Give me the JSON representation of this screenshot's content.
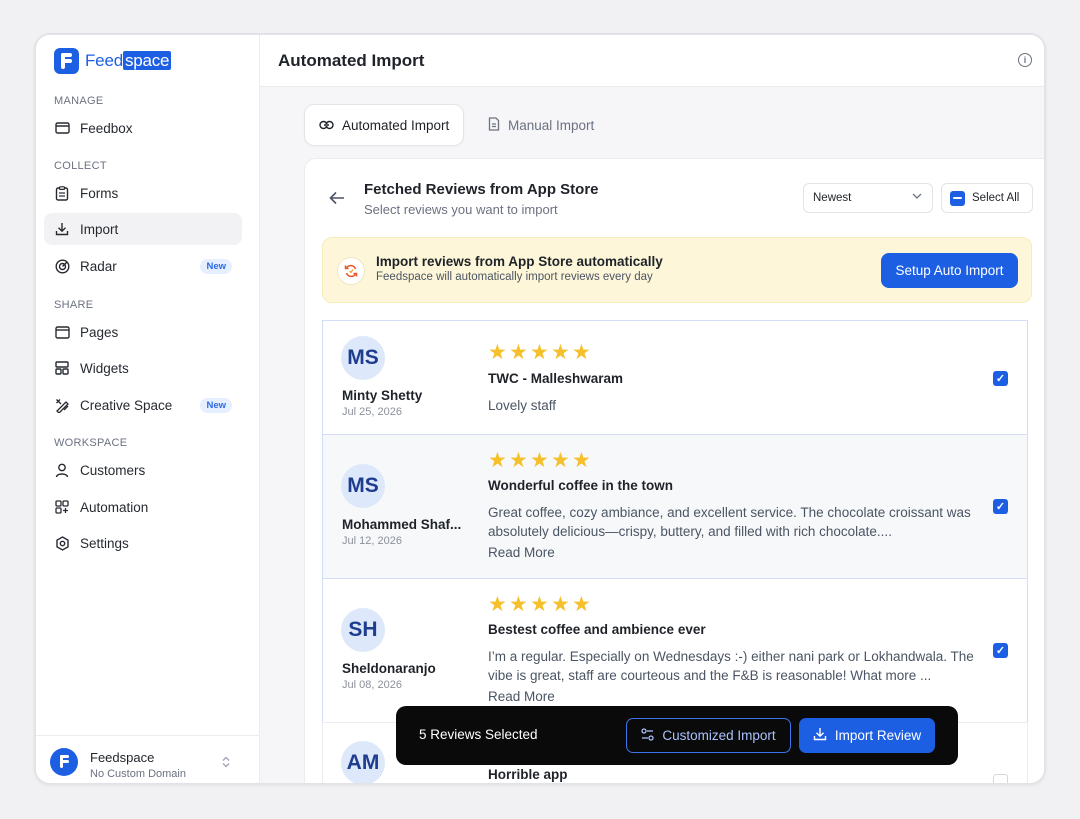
{
  "brand": {
    "name_part1": "Feed",
    "name_part2": "space"
  },
  "sidebar": {
    "sections": {
      "manage": "MANAGE",
      "collect": "COLLECT",
      "share": "SHARE",
      "workspace": "WORKSPACE"
    },
    "items": {
      "feedbox": "Feedbox",
      "forms": "Forms",
      "import": "Import",
      "radar": "Radar",
      "pages": "Pages",
      "widgets": "Widgets",
      "creative_space": "Creative Space",
      "customers": "Customers",
      "automation": "Automation",
      "settings": "Settings"
    },
    "badge_new": "New",
    "workspace": {
      "name": "Feedspace",
      "domain": "No Custom Domain"
    }
  },
  "header": {
    "title": "Automated Import"
  },
  "tabs": {
    "automated": "Automated Import",
    "manual": "Manual Import"
  },
  "panel": {
    "title": "Fetched Reviews from App Store",
    "subtitle": "Select reviews you want to import",
    "sort_value": "Newest",
    "select_all": "Select All"
  },
  "banner": {
    "title": "Import reviews from App Store automatically",
    "subtitle": "Feedspace will automatically import reviews every day",
    "button": "Setup Auto Import"
  },
  "reviews": [
    {
      "initials": "MS",
      "name": "Minty Shetty",
      "date": "Jul 25, 2026",
      "rating": 5,
      "title": "TWC - Malleshwaram",
      "body": "Lovely staff",
      "more": "",
      "checked": true
    },
    {
      "initials": "MS",
      "name": "Mohammed Shaf...",
      "date": "Jul 12, 2026",
      "rating": 5,
      "title": "Wonderful coffee in the town",
      "body": "Great coffee, cozy ambiance, and excellent service. The chocolate croissant was absolutely delicious—crispy, buttery, and filled with rich chocolate....",
      "more": "Read More",
      "checked": true
    },
    {
      "initials": "SH",
      "name": "Sheldonaranjo",
      "date": "Jul 08, 2026",
      "rating": 5,
      "title": "Bestest coffee and ambience ever",
      "body": "I’m a regular. Especially on Wednesdays :-) either nani park or Lokhandwala. The vibe is great, staff are courteous and the F&B is reasonable! What more ...",
      "more": "Read More",
      "checked": true
    },
    {
      "initials": "AM",
      "name": "",
      "date": "",
      "rating": 0,
      "title": "Horrible app",
      "body": "",
      "more": "",
      "checked": false
    }
  ],
  "bulk_bar": {
    "count_text": "5 Reviews Selected",
    "customized": "Customized Import",
    "import": "Import Review"
  },
  "colors": {
    "accent": "#1d5fe3",
    "star": "#f5c02b",
    "banner_bg": "#fdf6d8"
  }
}
